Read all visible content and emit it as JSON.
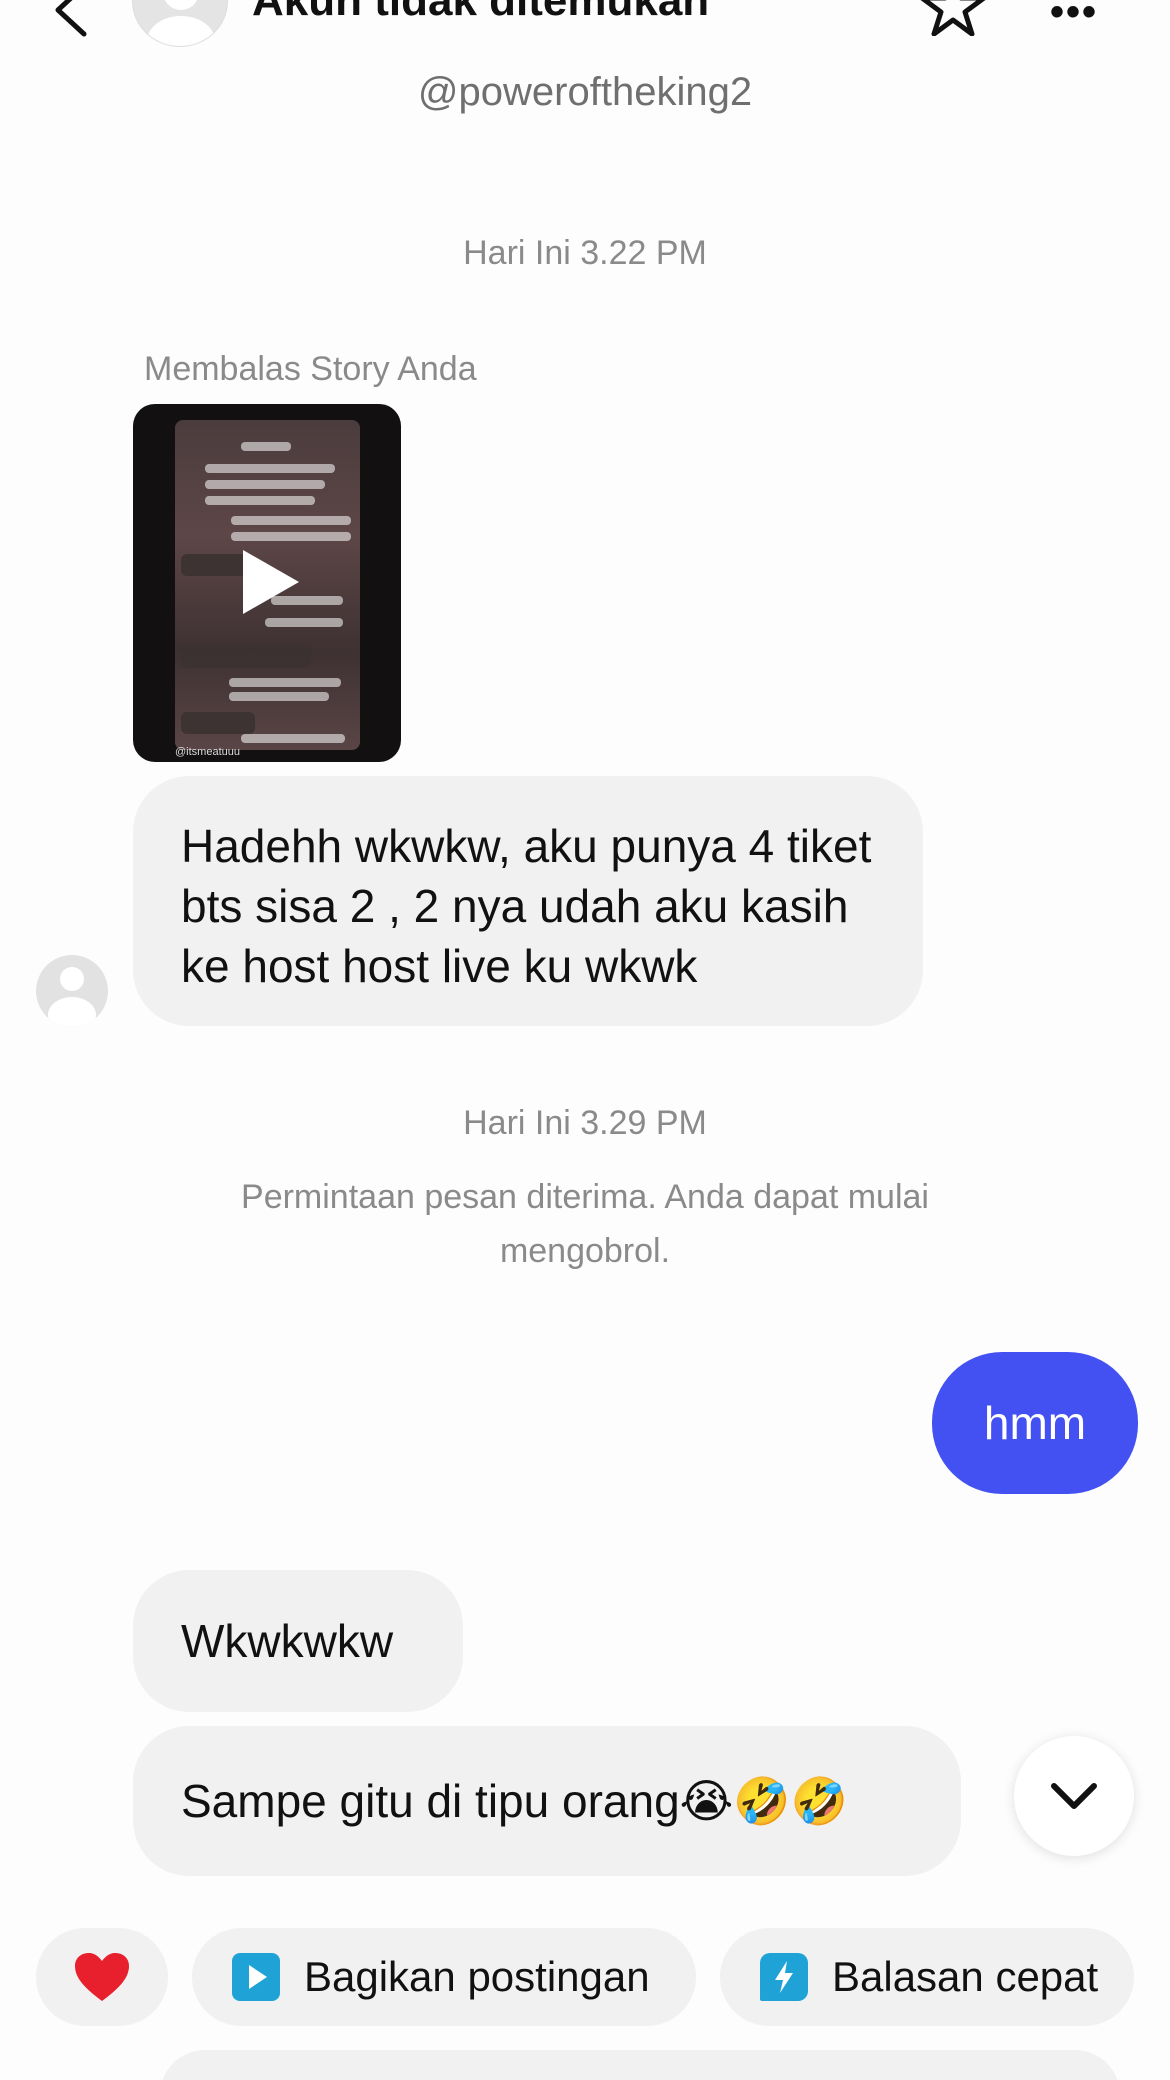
{
  "header": {
    "title": "Akun tidak ditemukan",
    "username": "@poweroftheking2"
  },
  "chat": {
    "timestamp_1": "Hari Ini 3.22 PM",
    "reply_label": "Membalas Story Anda",
    "story_credit": "@itsmeatuuu",
    "msg_1": "Hadehh wkwkw, aku punya 4 tiket bts sisa 2 , 2 nya udah aku kasih ke host host live ku wkwk",
    "timestamp_2": "Hari Ini 3.29 PM",
    "system_msg": "Permintaan pesan diterima. Anda dapat mulai mengobrol.",
    "msg_2": "hmm",
    "msg_3": "Wkwkwkw",
    "msg_4": "Sampe gitu di tipu orang😭🤣🤣"
  },
  "quick_actions": {
    "share_label": "Bagikan postingan",
    "quick_reply_label": "Balasan cepat"
  },
  "colors": {
    "outgoing_bubble": "#4451f2",
    "incoming_bubble": "#f1f1f1",
    "heart": "#e8202e",
    "share_icon": "#1fa3d6",
    "quick_reply_icon": "#1fa3d6"
  },
  "icons": [
    "back-arrow-icon",
    "avatar-icon",
    "star-icon",
    "more-icon",
    "play-icon",
    "chevron-down-icon",
    "heart-icon",
    "share-post-icon",
    "quick-reply-icon"
  ]
}
